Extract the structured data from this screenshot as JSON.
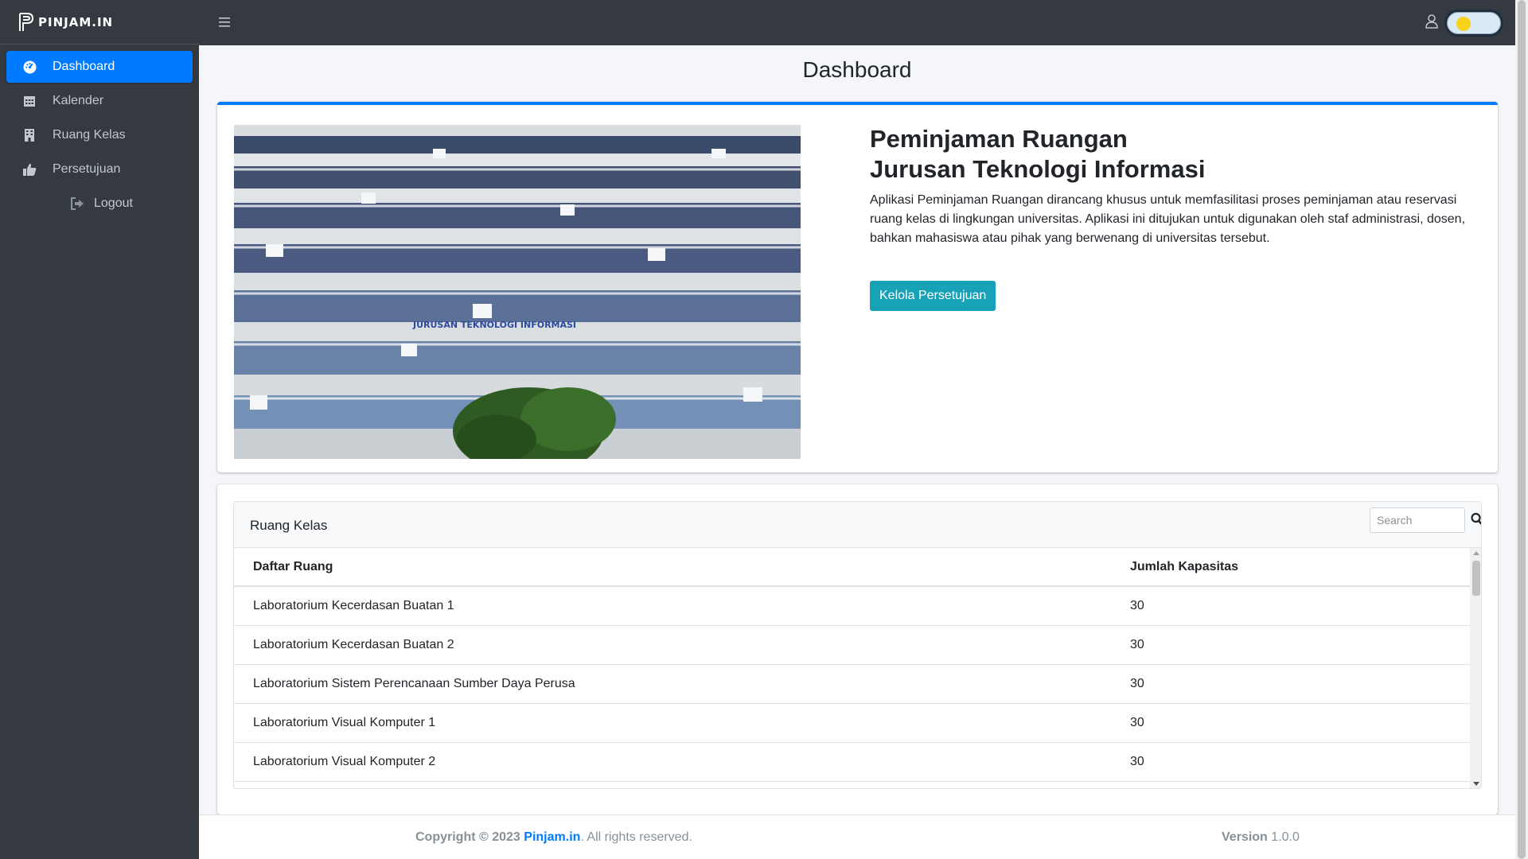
{
  "brand": {
    "name": "PINJAM.IN"
  },
  "sidebar": {
    "items": [
      {
        "label": "Dashboard",
        "icon": "tachometer-icon",
        "active": true
      },
      {
        "label": "Kalender",
        "icon": "calendar-icon"
      },
      {
        "label": "Ruang Kelas",
        "icon": "building-icon"
      },
      {
        "label": "Persetujuan",
        "icon": "thumbs-up-icon"
      },
      {
        "label": "Logout",
        "icon": "sign-out-icon"
      }
    ]
  },
  "page": {
    "title": "Dashboard"
  },
  "hero": {
    "heading_line1": "Peminjaman Ruangan",
    "heading_line2": "Jurusan Teknologi Informasi",
    "description": "Aplikasi Peminjaman Ruangan dirancang khusus untuk memfasilitasi proses peminjaman atau reservasi ruang kelas di lingkungan universitas. Aplikasi ini ditujukan untuk digunakan oleh staf administrasi, dosen, bahkan mahasiswa atau pihak yang berwenang di universitas tersebut.",
    "button_label": "Kelola Persetujuan",
    "image_sign_text": "JURUSAN TEKNOLOGI INFORMASI"
  },
  "rooms": {
    "title": "Ruang Kelas",
    "search_placeholder": "Search",
    "columns": [
      "Daftar Ruang",
      "Jumlah Kapasitas"
    ],
    "rows": [
      {
        "name": "Laboratorium Kecerdasan Buatan 1",
        "capacity": "30"
      },
      {
        "name": "Laboratorium Kecerdasan Buatan 2",
        "capacity": "30"
      },
      {
        "name": "Laboratorium Sistem Perencanaan Sumber Daya Perusa",
        "capacity": "30"
      },
      {
        "name": "Laboratorium Visual Komputer 1",
        "capacity": "30"
      },
      {
        "name": "Laboratorium Visual Komputer 2",
        "capacity": "30"
      }
    ]
  },
  "footer": {
    "copyright_prefix": "Copyright © 2023",
    "brand_link": "Pinjam.in",
    "suffix": ". All rights reserved.",
    "version_label": "Version",
    "version_value": "1.0.0"
  },
  "colors": {
    "accent": "#007bff",
    "sidebar_bg": "#343a40",
    "button_info": "#17a2b8",
    "toggle_knob": "#f8d21b"
  }
}
